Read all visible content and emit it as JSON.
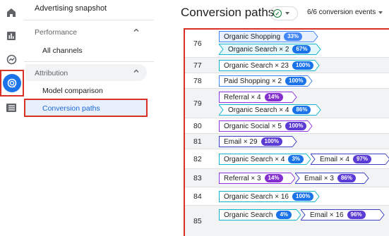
{
  "sidebar": {
    "title": "Advertising snapshot",
    "sections": [
      {
        "label": "Performance",
        "items": [
          "All channels"
        ]
      },
      {
        "label": "Attribution",
        "items": [
          "Model comparison",
          "Conversion paths"
        ]
      }
    ]
  },
  "header": {
    "title": "Conversion paths",
    "events_label": "6/6 conversion events"
  },
  "colors": {
    "organic_shopping": "#4285f4",
    "organic_search": "#12b5cb",
    "paid_shopping": "#4285f4",
    "referral": "#9334e6",
    "organic_social": "#9334e6",
    "email": "#3c40c6",
    "pill_purple": "#5b3bd6"
  },
  "rows": [
    {
      "num": "76",
      "chips": [
        {
          "label": "Organic Shopping",
          "pct": "33%"
        },
        {
          "label": "Organic Search × 2",
          "pct": "67%"
        }
      ]
    },
    {
      "num": "77",
      "chips": [
        {
          "label": "Organic Search × 23",
          "pct": "100%"
        }
      ]
    },
    {
      "num": "78",
      "chips": [
        {
          "label": "Paid Shopping × 2",
          "pct": "100%"
        }
      ]
    },
    {
      "num": "79",
      "chips": [
        {
          "label": "Referral × 4",
          "pct": "14%"
        },
        {
          "label": "Organic Search × 4",
          "pct": "86%"
        }
      ]
    },
    {
      "num": "80",
      "chips": [
        {
          "label": "Organic Social × 5",
          "pct": "100%"
        }
      ]
    },
    {
      "num": "81",
      "chips": [
        {
          "label": "Email × 29",
          "pct": "100%"
        }
      ]
    },
    {
      "num": "82",
      "chips": [
        {
          "label": "Organic Search × 4",
          "pct": "3%"
        },
        {
          "label": "Email × 4",
          "pct": "97%"
        }
      ]
    },
    {
      "num": "83",
      "chips": [
        {
          "label": "Referral × 3",
          "pct": "14%"
        },
        {
          "label": "Email × 3",
          "pct": "86%"
        }
      ]
    },
    {
      "num": "84",
      "chips": [
        {
          "label": "Organic Search × 16",
          "pct": "100%"
        }
      ]
    },
    {
      "num": "85",
      "chips": [
        {
          "label": "Organic Search",
          "pct": "4%"
        },
        {
          "label": "Email × 16",
          "pct": "96%"
        }
      ]
    }
  ]
}
